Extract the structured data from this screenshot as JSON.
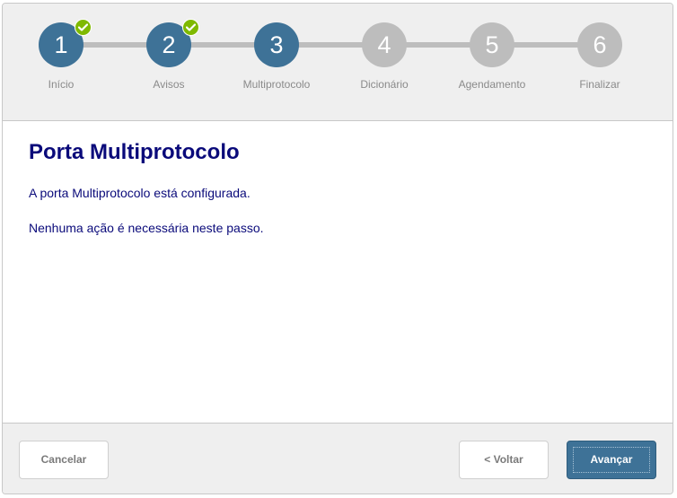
{
  "wizard": {
    "steps": [
      {
        "number": "1",
        "label": "Início",
        "state": "completed"
      },
      {
        "number": "2",
        "label": "Avisos",
        "state": "completed"
      },
      {
        "number": "3",
        "label": "Multiprotocolo",
        "state": "current"
      },
      {
        "number": "4",
        "label": "Dicionário",
        "state": "pending"
      },
      {
        "number": "5",
        "label": "Agendamento",
        "state": "pending"
      },
      {
        "number": "6",
        "label": "Finalizar",
        "state": "pending"
      }
    ]
  },
  "content": {
    "title": "Porta Multiprotocolo",
    "paragraph1": "A porta Multiprotocolo está configurada.",
    "paragraph2": "Nenhuma ação é necessária neste passo."
  },
  "footer": {
    "cancel_label": "Cancelar",
    "back_label": "< Voltar",
    "next_label": "Avançar"
  },
  "colors": {
    "accent": "#3e7297",
    "pending": "#bdbdbd",
    "check": "#7fb900",
    "heading_text": "#0a0a7a"
  },
  "icons": {
    "completed_badge": "checkmark-icon"
  }
}
